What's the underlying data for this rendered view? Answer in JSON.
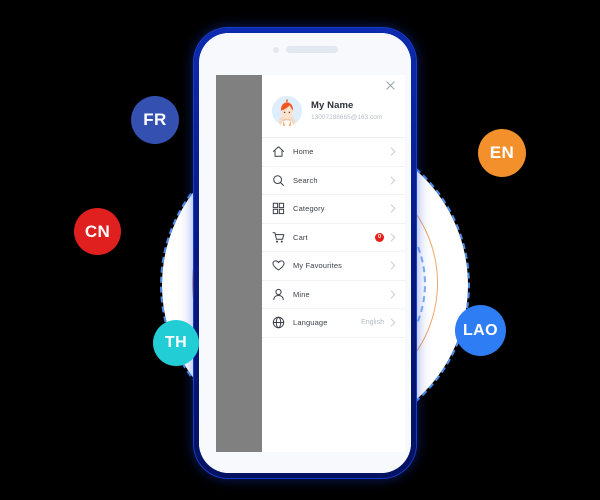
{
  "colors": {
    "background": "#000000",
    "phone_frame": "#0a2399",
    "phone_screen": "#f7f9fc",
    "drawer_scrim": "#808080",
    "accent_badge": "#e8201b",
    "ring_dashed": "#4f8ce8",
    "arc_orange": "#f0a868"
  },
  "phone": {
    "notch": {
      "camera_dot": "camera-dot",
      "speaker_grille": "speaker-grille"
    }
  },
  "drawer": {
    "close_label": "×",
    "profile": {
      "avatar": "user-avatar",
      "name": "My Name",
      "email": "13007288665@163.com"
    },
    "menu": [
      {
        "id": "home",
        "label": "Home",
        "icon": "home-icon",
        "value": "",
        "badge": ""
      },
      {
        "id": "search",
        "label": "Search",
        "icon": "search-icon",
        "value": "",
        "badge": ""
      },
      {
        "id": "category",
        "label": "Category",
        "icon": "category-icon",
        "value": "",
        "badge": ""
      },
      {
        "id": "cart",
        "label": "Cart",
        "icon": "cart-icon",
        "value": "",
        "badge": "0"
      },
      {
        "id": "favourites",
        "label": "My Favourites",
        "icon": "heart-icon",
        "value": "",
        "badge": ""
      },
      {
        "id": "mine",
        "label": "Mine",
        "icon": "person-icon",
        "value": "",
        "badge": ""
      },
      {
        "id": "language",
        "label": "Language",
        "icon": "globe-icon",
        "value": "English",
        "badge": ""
      }
    ]
  },
  "languages": [
    {
      "id": "fr",
      "label": "FR",
      "color": "#3451b2"
    },
    {
      "id": "cn",
      "label": "CN",
      "color": "#e01f1f"
    },
    {
      "id": "th",
      "label": "TH",
      "color": "#22cdd6"
    },
    {
      "id": "en",
      "label": "EN",
      "color": "#f3902c"
    },
    {
      "id": "lao",
      "label": "LAO",
      "color": "#2f7df4"
    }
  ]
}
